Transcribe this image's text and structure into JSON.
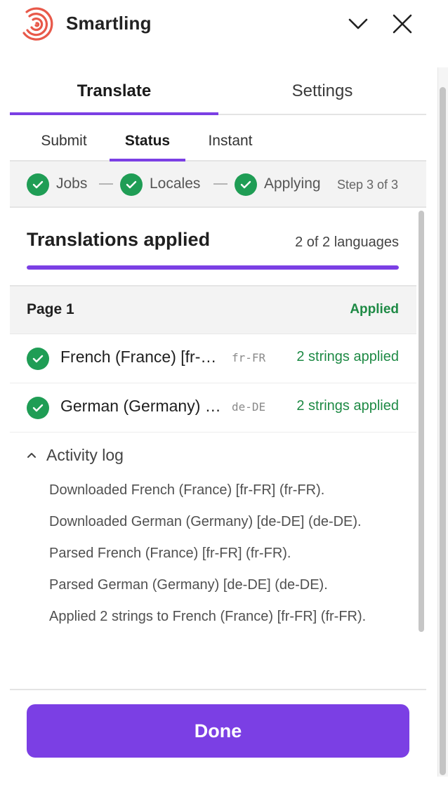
{
  "app": {
    "title": "Smartling"
  },
  "main_tabs": [
    {
      "label": "Translate",
      "active": true
    },
    {
      "label": "Settings",
      "active": false
    }
  ],
  "sub_tabs": [
    {
      "label": "Submit",
      "active": false
    },
    {
      "label": "Status",
      "active": true
    },
    {
      "label": "Instant",
      "active": false
    }
  ],
  "stepper": {
    "steps": [
      {
        "label": "Jobs",
        "done": true
      },
      {
        "label": "Locales",
        "done": true
      },
      {
        "label": "Applying",
        "done": true
      }
    ],
    "count": "Step 3 of 3"
  },
  "section": {
    "title": "Translations applied",
    "count": "2 of 2 languages",
    "progress_fraction": 1.0
  },
  "page": {
    "name": "Page 1",
    "status": "Applied"
  },
  "languages": [
    {
      "name": "French (France) [fr-FR]",
      "code": "fr-FR",
      "status": "2 strings applied"
    },
    {
      "name": "German (Germany) [de-DE]",
      "code": "de-DE",
      "status": "2 strings applied"
    }
  ],
  "activity_log": {
    "label": "Activity log",
    "expanded": true,
    "items": [
      "Downloaded French (France) [fr-FR] (fr-FR).",
      "Downloaded German (Germany) [de-DE] (de-DE).",
      "Parsed French (France) [fr-FR] (fr-FR).",
      "Parsed German (Germany) [de-DE] (de-DE).",
      "Applied 2 strings to French (France) [fr-FR] (fr-FR)."
    ]
  },
  "footer": {
    "done_label": "Done"
  },
  "colors": {
    "accent": "#7b3fe4",
    "success": "#1f9d55",
    "brand_logo": "#e8594a"
  }
}
